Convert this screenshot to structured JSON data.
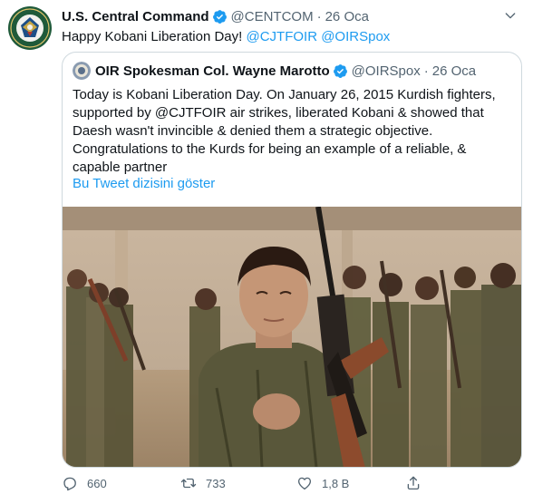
{
  "tweet": {
    "author_name": "U.S. Central Command",
    "handle": "@CENTCOM",
    "separator": "·",
    "date": "26 Oca",
    "text_prefix": "Happy Kobani Liberation Day! ",
    "mention_1": "@CJTFOIR",
    "mention_2": "@OIRSpox",
    "avatar_icon": "centcom-seal-icon",
    "more_icon": "chevron-down-icon"
  },
  "quoted": {
    "author_name": "OIR Spokesman Col. Wayne Marotto",
    "handle": "@OIRSpox",
    "separator": "·",
    "date": "26 Oca",
    "text": "Today is Kobani Liberation Day. On January 26, 2015 Kurdish fighters, supported by @CJTFOIR air strikes, liberated  Kobani & showed that Daesh wasn't invincible & denied them a strategic objective. Congratulations to the Kurds for being an example of a reliable, & capable partner",
    "show_thread": "Bu Tweet dizisini göster"
  },
  "actions": {
    "reply_count": "660",
    "retweet_count": "733",
    "like_count": "1,8 B",
    "reply_icon": "reply-icon",
    "retweet_icon": "retweet-icon",
    "like_icon": "heart-icon",
    "share_icon": "share-icon"
  },
  "colors": {
    "accent": "#1d9bf0",
    "text": "#0f1419",
    "secondary": "#536471",
    "border": "#cfd9de"
  }
}
